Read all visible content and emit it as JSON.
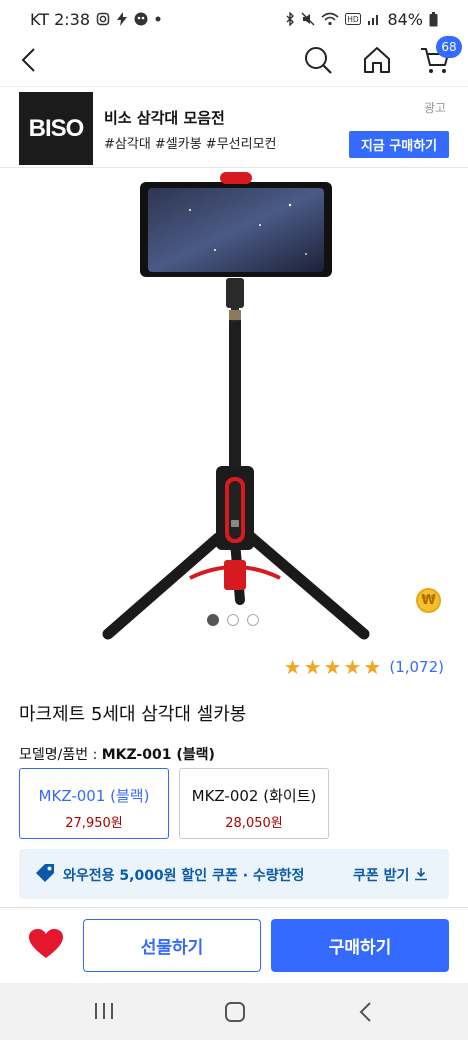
{
  "status_bar": {
    "carrier_time": "KT 2:38",
    "battery": "84%",
    "left_icons": [
      "instagram-icon",
      "bolt-icon",
      "app-icon",
      "dot-icon"
    ],
    "right_icons": [
      "bluetooth-icon",
      "mute-icon",
      "wifi-icon",
      "hd-icon",
      "signal-icon",
      "battery-icon"
    ]
  },
  "nav": {
    "cart_count": "68",
    "icons": [
      "back-icon",
      "search-icon",
      "home-icon",
      "cart-icon"
    ]
  },
  "ad": {
    "logo_text": "BISO",
    "title": "비소 삼각대 모음전",
    "tags": "#삼각대 #셀카봉 #무선리모컨",
    "label": "광고",
    "cta": "지금 구매하기"
  },
  "product": {
    "rating": 5,
    "review_count": "(1,072)",
    "title": "마크제트 5세대 삼각대 셀카봉",
    "option_prefix": "모델명/품번 : ",
    "option_selected": "MKZ-001 (블랙)",
    "image_count": 3,
    "image_index": 0
  },
  "options": [
    {
      "name": "MKZ-001 (블랙)",
      "price": "27,950원",
      "selected": true
    },
    {
      "name": "MKZ-002 (화이트)",
      "price": "28,050원",
      "selected": false
    }
  ],
  "coupon": {
    "text": "와우전용 5,000원 할인 쿠폰 · 수량한정",
    "action": "쿠폰 받기"
  },
  "bottom": {
    "gift": "선물하기",
    "buy": "구매하기"
  },
  "colors": {
    "accent": "#346aff",
    "price_red": "#ae0000",
    "heart": "#e5172f",
    "star": "#f5a623",
    "coupon_bg": "#ecf4fb"
  }
}
